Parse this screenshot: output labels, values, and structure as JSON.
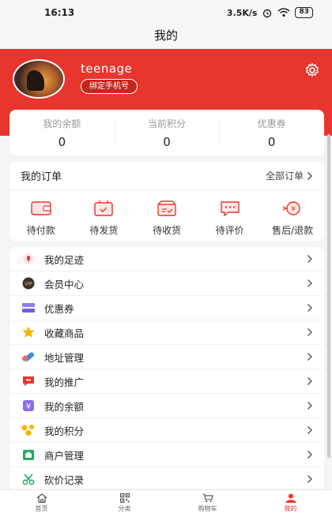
{
  "status_bar": {
    "time": "16:13",
    "speed": "3.5K/s",
    "battery": "83"
  },
  "page": {
    "title": "我的"
  },
  "profile": {
    "username": "teenage",
    "bind_phone_label": "绑定手机号"
  },
  "stats": [
    {
      "label": "我的余额",
      "value": "0"
    },
    {
      "label": "当前积分",
      "value": "0"
    },
    {
      "label": "优惠券",
      "value": "0"
    }
  ],
  "orders": {
    "title": "我的订单",
    "all_label": "全部订单",
    "items": [
      {
        "label": "待付款",
        "icon": "wallet-icon"
      },
      {
        "label": "待发货",
        "icon": "box-icon"
      },
      {
        "label": "待收货",
        "icon": "truck-icon"
      },
      {
        "label": "待评价",
        "icon": "comment-icon"
      },
      {
        "label": "售后/退款",
        "icon": "refund-icon"
      }
    ]
  },
  "menu": [
    {
      "label": "我的足迹",
      "icon": "footprint-icon",
      "color": "#d23b3b"
    },
    {
      "label": "会员中心",
      "icon": "vip-icon",
      "color": "#b8860b"
    },
    {
      "label": "优惠券",
      "icon": "coupon-icon",
      "color": "#6c5ce7"
    },
    {
      "label": "收藏商品",
      "icon": "star-icon",
      "color": "#f5b400"
    },
    {
      "label": "地址管理",
      "icon": "location-icon",
      "color": "#3a8ee6"
    },
    {
      "label": "我的推广",
      "icon": "promotion-icon",
      "color": "#e8352d"
    },
    {
      "label": "我的余额",
      "icon": "balance-icon",
      "color": "#8e6cf0"
    },
    {
      "label": "我的积分",
      "icon": "points-icon",
      "color": "#f5b400"
    },
    {
      "label": "商户管理",
      "icon": "store-icon",
      "color": "#1aad5b"
    },
    {
      "label": "砍价记录",
      "icon": "bargain-icon",
      "color": "#1aad5b"
    }
  ],
  "tabbar": [
    {
      "label": "首页",
      "icon": "home-icon"
    },
    {
      "label": "分类",
      "icon": "qr-icon"
    },
    {
      "label": "购物车",
      "icon": "cart-icon"
    },
    {
      "label": "我的",
      "icon": "user-icon",
      "active": true
    }
  ],
  "colors": {
    "brand": "#e8352d",
    "background": "#f4f4f4"
  }
}
